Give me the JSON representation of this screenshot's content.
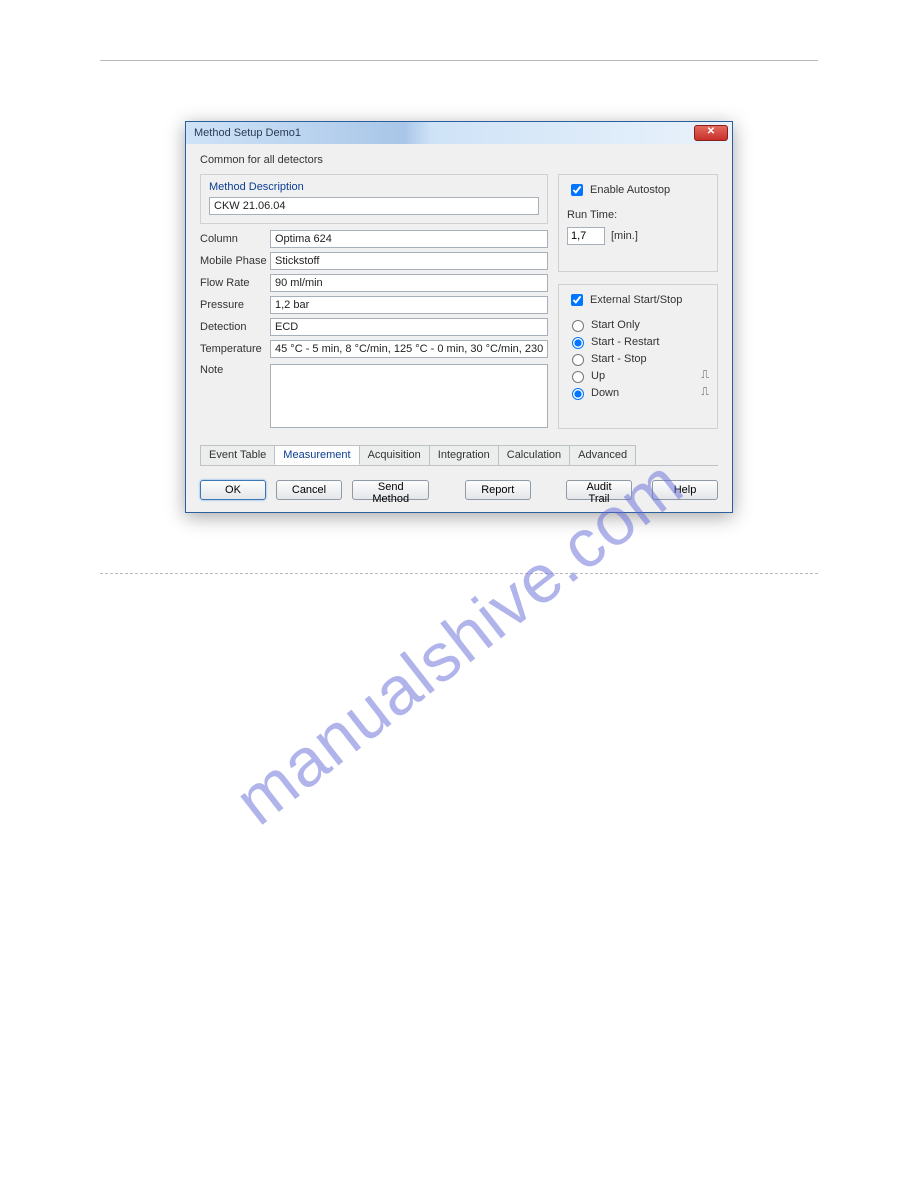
{
  "watermark": "manualshive.com",
  "dialog": {
    "title": "Method Setup Demo1",
    "common_label": "Common for all detectors",
    "method_description_label": "Method Description",
    "method_description_value": "CKW 21.06.04",
    "fields": {
      "column_label": "Column",
      "column_value": "Optima 624",
      "mobile_phase_label": "Mobile Phase",
      "mobile_phase_value": "Stickstoff",
      "flow_rate_label": "Flow Rate",
      "flow_rate_value": "90 ml/min",
      "pressure_label": "Pressure",
      "pressure_value": "1,2 bar",
      "detection_label": "Detection",
      "detection_value": "ECD",
      "temperature_label": "Temperature",
      "temperature_value": "45 °C - 5 min, 8 °C/min, 125 °C - 0 min, 30 °C/min, 230",
      "note_label": "Note",
      "note_value": ""
    },
    "autostop": {
      "enable_label": "Enable Autostop",
      "enable_checked": true,
      "run_time_label": "Run Time:",
      "run_time_value": "1,7",
      "run_time_unit": "[min.]"
    },
    "ext": {
      "group_label": "External Start/Stop",
      "group_checked": true,
      "start_only": "Start Only",
      "start_restart": "Start - Restart",
      "start_stop": "Start - Stop",
      "up": "Up",
      "down": "Down",
      "selected_mode": "start_restart",
      "selected_edge": "down"
    },
    "tabs": {
      "event_table": "Event Table",
      "measurement": "Measurement",
      "acquisition": "Acquisition",
      "integration": "Integration",
      "calculation": "Calculation",
      "advanced": "Advanced",
      "active": "measurement"
    },
    "buttons": {
      "ok": "OK",
      "cancel": "Cancel",
      "send_method": "Send Method",
      "report": "Report",
      "audit_trail": "Audit Trail",
      "help": "Help"
    }
  }
}
